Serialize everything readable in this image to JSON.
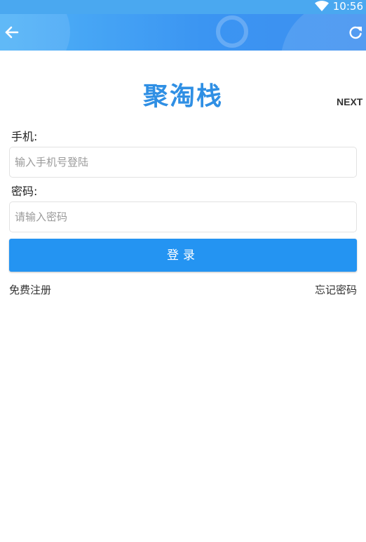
{
  "status_bar": {
    "time": "10:56",
    "wifi_icon": "wifi-icon",
    "background": "#4aa8f0"
  },
  "header": {
    "back_icon": "arrow-left-icon",
    "refresh_icon": "refresh-icon"
  },
  "app": {
    "title": "聚淘栈",
    "next": "NEXT"
  },
  "form": {
    "phone_label": "手机:",
    "phone_placeholder": "输入手机号登陆",
    "phone_value": "",
    "password_label": "密码:",
    "password_placeholder": "请输入密码",
    "password_value": "",
    "login_button": "登录"
  },
  "links": {
    "register": "免费注册",
    "forgot_password": "忘记密码"
  },
  "colors": {
    "accent": "#2494f2",
    "title": "#2f8fe4",
    "header_start": "#4fb2f7",
    "header_end": "#3d8ff0"
  }
}
